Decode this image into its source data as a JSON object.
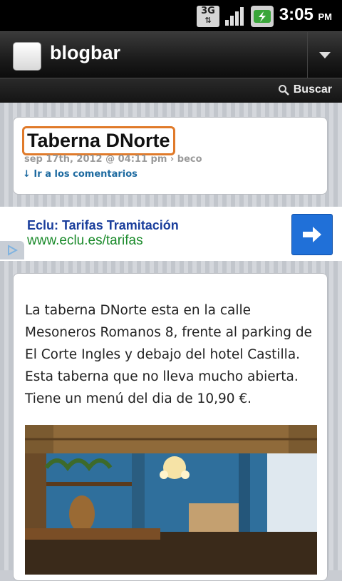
{
  "status_bar": {
    "network": "3G",
    "time": "3:05",
    "ampm": "PM"
  },
  "app_bar": {
    "title": "blogbar"
  },
  "search": {
    "label": "Buscar"
  },
  "post": {
    "title": "Taberna DNorte",
    "meta": "sep 17th, 2012 @ 04:11 pm › beco",
    "comments_link": "↓ Ir a los comentarios"
  },
  "ad": {
    "title": "Eclu: Tarifas Tramitación",
    "url": "www.eclu.es/tarifas"
  },
  "body": {
    "text": "La taberna DNorte esta en la calle Mesoneros Romanos 8, frente al parking de El Corte Ingles y debajo del  hotel Castilla.  Esta taberna que no lleva mucho abierta. Tiene un menú del dia de 10,90 €."
  },
  "colors": {
    "accent_orange": "#e07a2a",
    "link_blue": "#1d6aa0",
    "ad_title_blue": "#1a3e9c",
    "ad_url_green": "#1a8a2a",
    "ad_button_blue": "#2070d8"
  }
}
